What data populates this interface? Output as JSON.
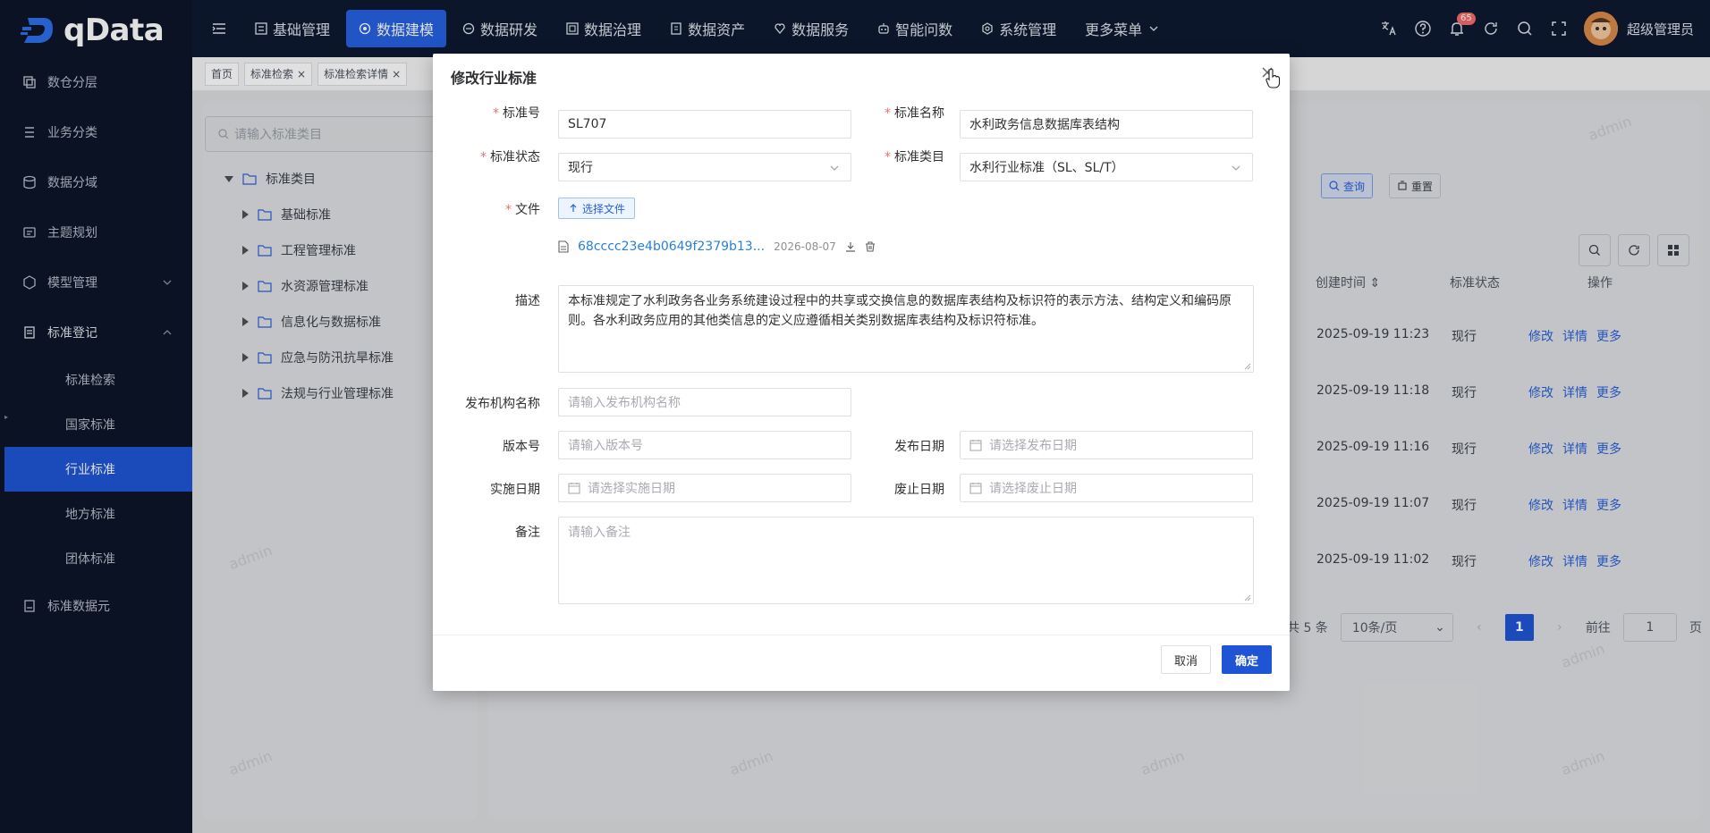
{
  "app": {
    "logo_text": "qData"
  },
  "sidebar": {
    "items": [
      {
        "label": "数仓分层",
        "icon": "layers-icon"
      },
      {
        "label": "业务分类",
        "icon": "list-icon"
      },
      {
        "label": "数据分域",
        "icon": "domain-icon"
      },
      {
        "label": "主题规划",
        "icon": "theme-icon"
      },
      {
        "label": "模型管理",
        "icon": "model-icon"
      },
      {
        "label": "标准登记",
        "icon": "register-icon"
      }
    ],
    "sub_items": [
      "标准检索",
      "国家标准",
      "行业标准",
      "地方标准",
      "团体标准"
    ],
    "last_item": {
      "label": "标准数据元",
      "icon": "data-element-icon"
    }
  },
  "topbar": {
    "nav": [
      "基础管理",
      "数据建模",
      "数据研发",
      "数据治理",
      "数据资产",
      "数据服务",
      "智能问数",
      "系统管理",
      "更多菜单"
    ],
    "active_nav": "数据建模",
    "notification_count": "65",
    "user_name": "超级管理员"
  },
  "tags": [
    "首页",
    "标准检索",
    "标准检索详情"
  ],
  "tree": {
    "search_placeholder": "请输入标准类目",
    "root": "标准类目",
    "children": [
      "基础标准",
      "工程管理标准",
      "水资源管理标准",
      "信息化与数据标准",
      "应急与防汛抗旱标准",
      "法规与行业管理标准"
    ]
  },
  "main": {
    "query_button": "查询",
    "reset_button": "重置",
    "columns": {
      "created": "创建时间",
      "status": "标准状态",
      "actions": "操作"
    },
    "rows": [
      {
        "created": "2025-09-19 11:23",
        "status": "现行"
      },
      {
        "created": "2025-09-19 11:18",
        "status": "现行"
      },
      {
        "created": "2025-09-19 11:16",
        "status": "现行"
      },
      {
        "created": "2025-09-19 11:07",
        "status": "现行"
      },
      {
        "created": "2025-09-19 11:02",
        "status": "现行"
      }
    ],
    "actions": {
      "edit": "修改",
      "detail": "详情",
      "more": "更多"
    },
    "pagination": {
      "total": "共 5 条",
      "page_size": "10条/页",
      "current": "1",
      "goto_label": "前往",
      "goto_value": "1",
      "page_suffix": "页"
    },
    "watermark": "admin"
  },
  "modal": {
    "title": "修改行业标准",
    "fields": {
      "code": {
        "label": "标准号",
        "value": "SL707"
      },
      "name": {
        "label": "标准名称",
        "value": "水利政务信息数据库表结构"
      },
      "status": {
        "label": "标准状态",
        "value": "现行"
      },
      "category": {
        "label": "标准类目",
        "value": "水利行业标准（SL、SL/T）"
      },
      "file": {
        "label": "文件",
        "button": "选择文件",
        "file_name": "68cccc23e4b0649f2379b13...",
        "file_date": "2026-08-07"
      },
      "description": {
        "label": "描述",
        "value": "本标准规定了水利政务各业务系统建设过程中的共享或交换信息的数据库表结构及标识符的表示方法、结构定义和编码原则。各水利政务应用的其他类信息的定义应遵循相关类别数据库表结构及标识符标准。"
      },
      "publisher": {
        "label": "发布机构名称",
        "placeholder": "请输入发布机构名称"
      },
      "version": {
        "label": "版本号",
        "placeholder": "请输入版本号"
      },
      "publish_date": {
        "label": "发布日期",
        "placeholder": "请选择发布日期"
      },
      "effective_date": {
        "label": "实施日期",
        "placeholder": "请选择实施日期"
      },
      "abolish_date": {
        "label": "废止日期",
        "placeholder": "请选择废止日期"
      },
      "remark": {
        "label": "备注",
        "placeholder": "请输入备注"
      }
    },
    "cancel": "取消",
    "confirm": "确定"
  }
}
